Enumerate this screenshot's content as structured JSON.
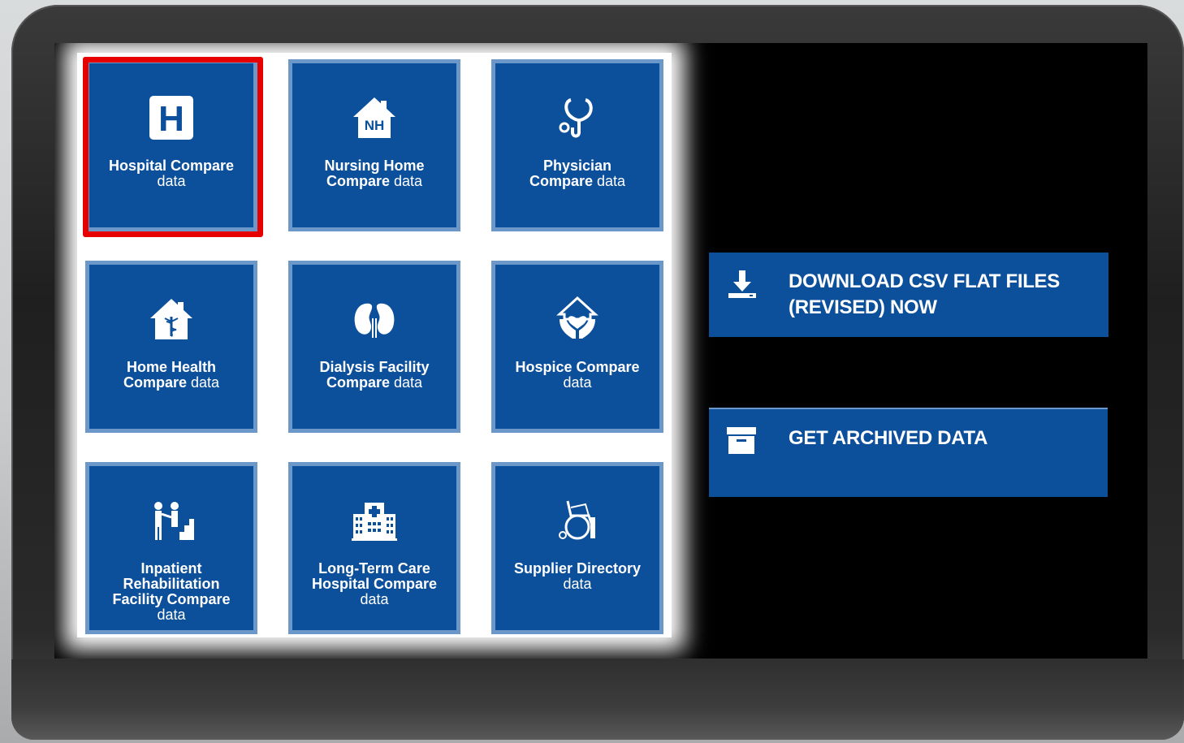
{
  "tiles": [
    {
      "title": "Hospital Compare",
      "sub": "data",
      "icon": "hospital-h-icon"
    },
    {
      "title": "Nursing Home\nCompare",
      "sub": "data",
      "icon": "nursing-home-icon",
      "icon_text": "NH"
    },
    {
      "title": "Physician\nCompare",
      "sub": "data",
      "icon": "stethoscope-icon"
    },
    {
      "title": "Home Health\nCompare",
      "sub": "data",
      "icon": "home-health-icon"
    },
    {
      "title": "Dialysis Facility\nCompare",
      "sub": "data",
      "icon": "kidney-icon"
    },
    {
      "title": "Hospice Compare",
      "sub": "data",
      "icon": "hospice-heart-hands-icon"
    },
    {
      "title": "Inpatient\nRehabilitation\nFacility Compare",
      "sub": "data",
      "icon": "rehabilitation-icon"
    },
    {
      "title": "Long-Term Care\nHospital Compare",
      "sub": "data",
      "icon": "long-term-care-building-icon"
    },
    {
      "title": "Supplier Directory",
      "sub": "data",
      "icon": "wheelchair-icon"
    }
  ],
  "hospital_h_letter": "H",
  "buttons": {
    "download": {
      "line1": "DOWNLOAD CSV FLAT FILES",
      "line2": "(REVISED) NOW",
      "icon": "download-icon"
    },
    "archive": {
      "label": "GET ARCHIVED DATA",
      "icon": "archive-box-icon"
    }
  },
  "colors": {
    "tile_blue": "#0c4f9a",
    "highlight_red": "#e60000"
  }
}
